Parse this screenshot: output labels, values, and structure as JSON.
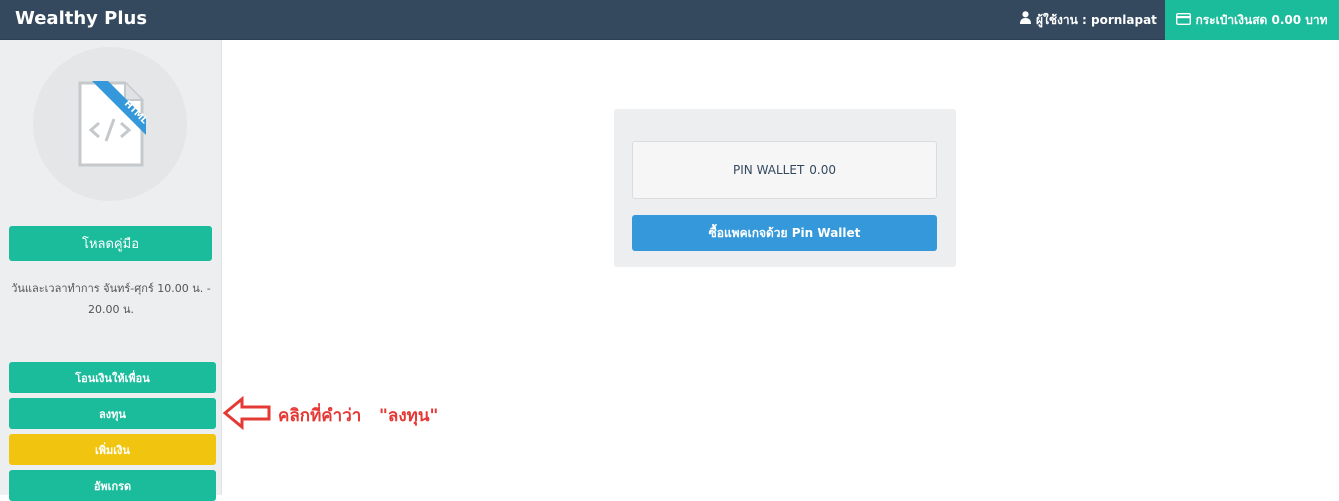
{
  "header": {
    "brand": "Wealthy Plus",
    "user_label": "ผู้ใช้งาน : pornlapat",
    "wallet_label": "กระเป๋าเงินสด 0.00 บาท"
  },
  "sidebar": {
    "manual_button": "โหลดคู่มือ",
    "hours_text": "วันและเวลาทำการ จันทร์-ศุกร์ 10.00 น. - 20.00 น.",
    "buttons": [
      {
        "label": "โอนเงินให้เพื่อน",
        "color": "#1abc9c"
      },
      {
        "label": "ลงทุน",
        "color": "#1abc9c"
      },
      {
        "label": "เพิ่มเงิน",
        "color": "#f1c40f"
      },
      {
        "label": "อัพเกรด",
        "color": "#1abc9c"
      }
    ]
  },
  "annotation": {
    "text": "คลิกที่คำว่า   \"ลงทุน\"",
    "color": "#e53935"
  },
  "main": {
    "pin_wallet_label": "PIN WALLET",
    "pin_wallet_value": "0.00",
    "buy_button": "ซื้อแพคเกจด้วย Pin Wallet"
  },
  "icons": {
    "user": "user-icon",
    "wallet": "wallet-icon",
    "avatar": "html-file-icon",
    "annotation": "arrow-left-icon"
  },
  "colors": {
    "topbar": "#34495e",
    "accent": "#1abc9c",
    "primary": "#3498db",
    "warning": "#f1c40f"
  }
}
